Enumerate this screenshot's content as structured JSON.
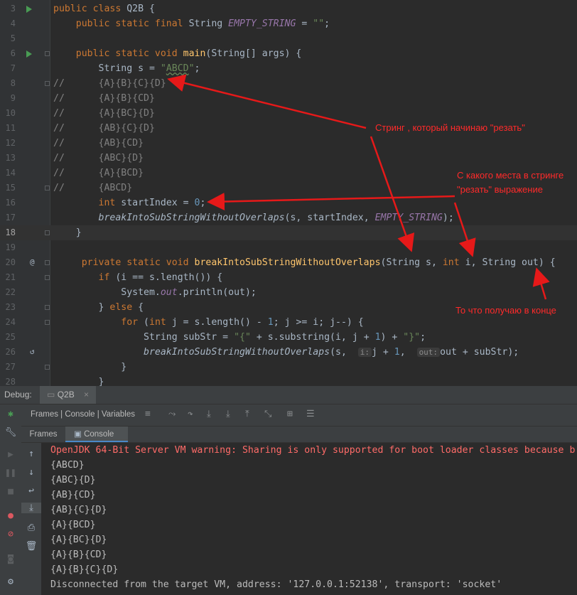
{
  "editor": {
    "lines": [
      {
        "n": "3",
        "html": "<span class=\"kw\">public class </span>Q2B {"
      },
      {
        "n": "4",
        "html": "    <span class=\"kw\">public static final </span>String <span class=\"ital\">EMPTY_STRING </span>= <span class=\"str\">\"\"</span>;"
      },
      {
        "n": "5",
        "html": ""
      },
      {
        "n": "6",
        "html": "    <span class=\"kw\">public static void </span><span class=\"fn\">main</span>(String[] args) {"
      },
      {
        "n": "7",
        "html": "        String s = <span class=\"str\">\"<span class=\"wavy\">ABCD</span>\"</span>;"
      },
      {
        "n": "8",
        "html": "<span class=\"cmt\">//      {A}{B}{C}{D}</span>"
      },
      {
        "n": "9",
        "html": "<span class=\"cmt\">//      {A}{B}{CD}</span>"
      },
      {
        "n": "10",
        "html": "<span class=\"cmt\">//      {A}{BC}{D}</span>"
      },
      {
        "n": "11",
        "html": "<span class=\"cmt\">//      {AB}{C}{D}</span>"
      },
      {
        "n": "12",
        "html": "<span class=\"cmt\">//      {AB}{CD}</span>"
      },
      {
        "n": "13",
        "html": "<span class=\"cmt\">//      {ABC}{D}</span>"
      },
      {
        "n": "14",
        "html": "<span class=\"cmt\">//      {A}{BCD}</span>"
      },
      {
        "n": "15",
        "html": "<span class=\"cmt\">//      {ABCD}</span>"
      },
      {
        "n": "16",
        "html": "        <span class=\"kw\">int </span>startIndex = <span class=\"num-lit\">0</span>;"
      },
      {
        "n": "17",
        "html": "        <span class=\"it-call\">breakIntoSubStringWithoutOverlaps</span>(s, startIndex, <span class=\"ital\">EMPTY_STRING</span>);"
      },
      {
        "n": "18",
        "html": "    }"
      },
      {
        "n": "19",
        "html": ""
      },
      {
        "n": "20",
        "html": "     <span class=\"kw\">private static void </span><span class=\"fn\">breakIntoSubStringWithoutOverlaps</span>(String s, <span class=\"kw\">int </span>i, String out) {"
      },
      {
        "n": "21",
        "html": "        <span class=\"kw\">if </span>(i == s.length()) {"
      },
      {
        "n": "22",
        "html": "            System.<span class=\"out-field\">out</span>.println(out);"
      },
      {
        "n": "23",
        "html": "        } <span class=\"kw\">else </span>{"
      },
      {
        "n": "24",
        "html": "            <span class=\"kw\">for </span>(<span class=\"kw\">int </span>j = s.length() - <span class=\"num-lit\">1</span>; j >= i; j--) {"
      },
      {
        "n": "25",
        "html": "                String subStr = <span class=\"str\">\"{\" </span>+ s.substring(i, j + <span class=\"num-lit\">1</span>) + <span class=\"str\">\"}\"</span>;"
      },
      {
        "n": "26",
        "html": "                <span class=\"it-call\">breakIntoSubStringWithoutOverlaps</span>(s,  <span class=\"hint\">i:</span>j + <span class=\"num-lit\">1</span>,  <span class=\"hint\">out:</span>out + subStr);"
      },
      {
        "n": "27",
        "html": "            }"
      },
      {
        "n": "28",
        "html": "        }"
      }
    ]
  },
  "annotations": {
    "string_to_cut": "Стринг , который начинаю \"резать\"",
    "from_where_1": "С какого места в стринге",
    "from_where_2": "\"резать\" выражение",
    "result": "То что получаю в конце"
  },
  "debug": {
    "label": "Debug:",
    "tab": "Q2B",
    "tab_close": "×",
    "toolbar_title": "Frames | Console | Variables",
    "subtab_frames": "Frames",
    "subtab_console": "Console"
  },
  "console": {
    "lines": [
      "OpenJDK 64-Bit Server VM warning: Sharing is only supported for boot loader classes because b",
      "{ABCD}",
      "{ABC}{D}",
      "{AB}{CD}",
      "{AB}{C}{D}",
      "{A}{BCD}",
      "{A}{BC}{D}",
      "{A}{B}{CD}",
      "{A}{B}{C}{D}",
      "Disconnected from the target VM, address: '127.0.0.1:52138', transport: 'socket'"
    ]
  },
  "colors": {
    "accent": "#4a88c7",
    "annotation": "#ff2a2a",
    "warning": "#ff6b68"
  }
}
